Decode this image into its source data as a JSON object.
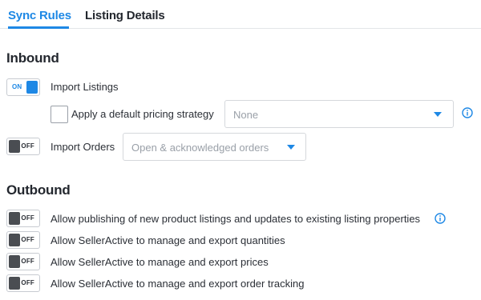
{
  "tabs": [
    {
      "label": "Sync Rules",
      "active": true
    },
    {
      "label": "Listing Details",
      "active": false
    }
  ],
  "inbound": {
    "title": "Inbound",
    "import_listings": {
      "toggle_label": "ON",
      "label": "Import Listings"
    },
    "default_pricing": {
      "label": "Apply a default pricing strategy",
      "checked": false,
      "select_value": "None"
    },
    "import_orders": {
      "toggle_label": "OFF",
      "label": "Import Orders",
      "select_value": "Open & acknowledged orders"
    }
  },
  "outbound": {
    "title": "Outbound",
    "rules": [
      {
        "toggle_label": "OFF",
        "label": "Allow publishing of new product listings and updates to existing listing properties"
      },
      {
        "toggle_label": "OFF",
        "label": "Allow SellerActive to manage and export quantities"
      },
      {
        "toggle_label": "OFF",
        "label": "Allow SellerActive to manage and export prices"
      },
      {
        "toggle_label": "OFF",
        "label": "Allow SellerActive to manage and export order tracking"
      }
    ]
  },
  "colors": {
    "accent": "#1e88e5",
    "toggle_off_knob": "#4a4d52",
    "placeholder": "#9aa0a8"
  },
  "icons": [
    "info-icon",
    "chevron-down-icon"
  ]
}
